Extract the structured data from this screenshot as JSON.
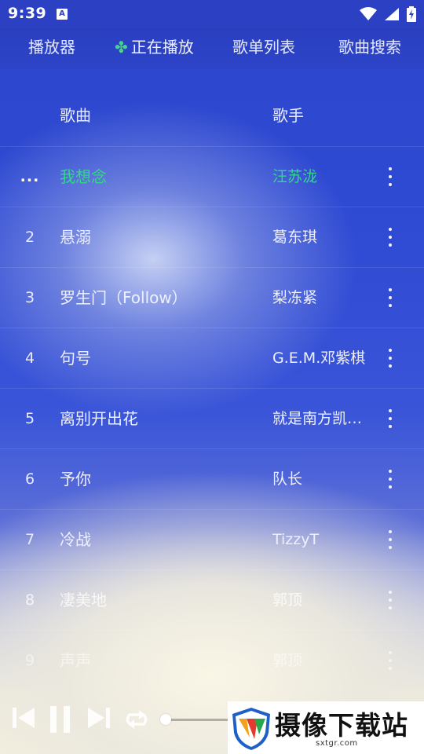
{
  "status_bar": {
    "time": "9:39",
    "notification_icon": "A"
  },
  "tabs": [
    {
      "label": "播放器"
    },
    {
      "label": "正在播放",
      "icon": "clover-icon",
      "icon_color": "#46d48c"
    },
    {
      "label": "歌单列表"
    },
    {
      "label": "歌曲搜索"
    }
  ],
  "table": {
    "header_song": "歌曲",
    "header_artist": "歌手",
    "rows": [
      {
        "num": "...",
        "title": "我想念",
        "artist": "汪苏泷",
        "playing": true
      },
      {
        "num": "2",
        "title": "悬溺",
        "artist": "葛东琪"
      },
      {
        "num": "3",
        "title": "罗生门（Follow）",
        "artist": "梨冻紧"
      },
      {
        "num": "4",
        "title": "句号",
        "artist": "G.E.M.邓紫棋"
      },
      {
        "num": "5",
        "title": "离别开出花",
        "artist": "就是南方凯…"
      },
      {
        "num": "6",
        "title": "予你",
        "artist": "队长"
      },
      {
        "num": "7",
        "title": "冷战",
        "artist": "TizzyT"
      },
      {
        "num": "8",
        "title": "凄美地",
        "artist": "郭顶"
      },
      {
        "num": "9",
        "title": "声声",
        "artist": "郭顶"
      }
    ]
  },
  "player": {
    "progress": 0.0
  },
  "watermark": {
    "text": "摄像下载站",
    "url": "sxtgr.com"
  },
  "colors": {
    "accent_playing": "#34d68c",
    "header_bg": "#2b40c2"
  }
}
